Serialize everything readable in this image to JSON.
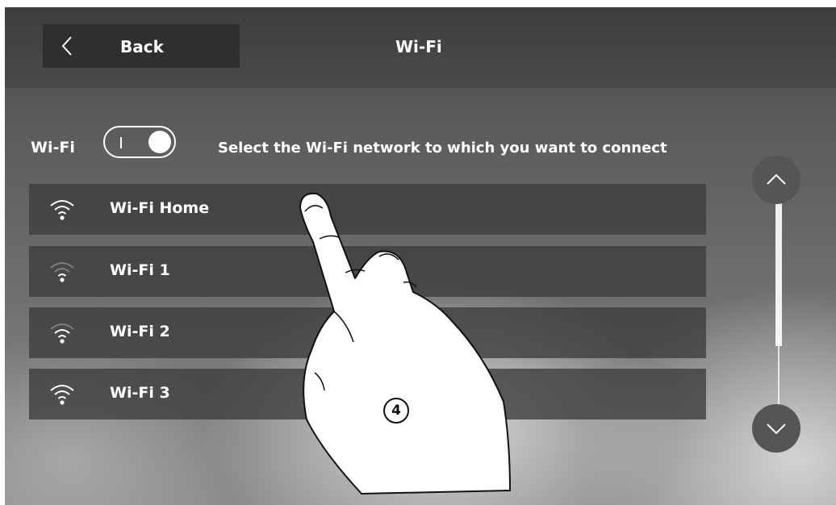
{
  "header": {
    "back_label": "Back",
    "title": "Wi-Fi"
  },
  "wifi_toggle": {
    "label": "Wi-Fi",
    "state": "on"
  },
  "hint_text": "Select the Wi-Fi network to which you want to connect",
  "networks": [
    {
      "name": "Wi-Fi Home",
      "signal_level": 4
    },
    {
      "name": "Wi-Fi 1",
      "signal_level": 1
    },
    {
      "name": "Wi-Fi 2",
      "signal_level": 2
    },
    {
      "name": "Wi-Fi 3",
      "signal_level": 3
    }
  ],
  "scroll": {
    "up_icon": "chevron-up-icon",
    "down_icon": "chevron-down-icon"
  },
  "annotation": {
    "step_number": "4",
    "pointer": "hand-pointer-icon"
  }
}
